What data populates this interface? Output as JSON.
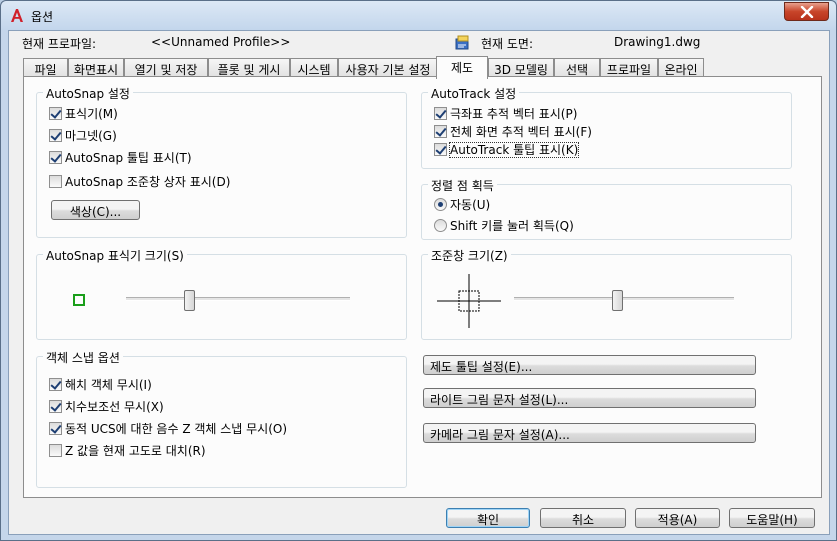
{
  "window": {
    "title": "옵션",
    "close_label": "×"
  },
  "header": {
    "profile_label": "현재 프로파일:",
    "profile_value": "<<Unnamed Profile>>",
    "drawing_label": "현재 도면:",
    "drawing_value": "Drawing1.dwg"
  },
  "tabs": [
    {
      "label": "파일"
    },
    {
      "label": "화면표시"
    },
    {
      "label": "열기 및 저장"
    },
    {
      "label": "플롯 및 게시"
    },
    {
      "label": "시스템"
    },
    {
      "label": "사용자 기본 설정"
    },
    {
      "label": "제도",
      "active": true
    },
    {
      "label": "3D 모델링"
    },
    {
      "label": "선택"
    },
    {
      "label": "프로파일"
    },
    {
      "label": "온라인"
    }
  ],
  "autosnap": {
    "title": "AutoSnap 설정",
    "items": [
      {
        "label": "표식기(M)",
        "checked": true
      },
      {
        "label": "마그넷(G)",
        "checked": true
      },
      {
        "label": "AutoSnap 툴팁 표시(T)",
        "checked": true
      },
      {
        "label": "AutoSnap 조준창 상자 표시(D)",
        "checked": false
      }
    ],
    "color_button": "색상(C)..."
  },
  "autosnap_size": {
    "title": "AutoSnap 표식기 크기(S)",
    "marker_color": "#1a9e1a",
    "slider_value": 0.28
  },
  "osnap": {
    "title": "객체 스냅 옵션",
    "items": [
      {
        "label": "해치 객체 무시(I)",
        "checked": true
      },
      {
        "label": "치수보조선 무시(X)",
        "checked": true
      },
      {
        "label": "동적 UCS에 대한 음수 Z 객체 스냅 무시(O)",
        "checked": true
      },
      {
        "label": "Z 값을 현재 고도로 대치(R)",
        "checked": false
      }
    ]
  },
  "autotrack": {
    "title": "AutoTrack 설정",
    "items": [
      {
        "label": "극좌표 추적 벡터 표시(P)",
        "checked": true
      },
      {
        "label": "전체 화면 추적 벡터 표시(F)",
        "checked": true
      },
      {
        "label": "AutoTrack 툴팁 표시(K)",
        "checked": true
      }
    ]
  },
  "alignment": {
    "title": "정렬 점 획득",
    "options": [
      {
        "label": "자동(U)",
        "selected": true
      },
      {
        "label": "Shift 키를 눌러 획득(Q)",
        "selected": false
      }
    ]
  },
  "aperture": {
    "title": "조준창 크기(Z)",
    "slider_value": 0.47
  },
  "buttons": {
    "tooltip_settings": "제도 툴팁 설정(E)...",
    "light_glyph": "라이트 그림 문자 설정(L)...",
    "camera_glyph": "카메라 그림 문자 설정(A)..."
  },
  "footer": {
    "ok": "확인",
    "cancel": "취소",
    "apply": "적용(A)",
    "help": "도움말(H)"
  }
}
